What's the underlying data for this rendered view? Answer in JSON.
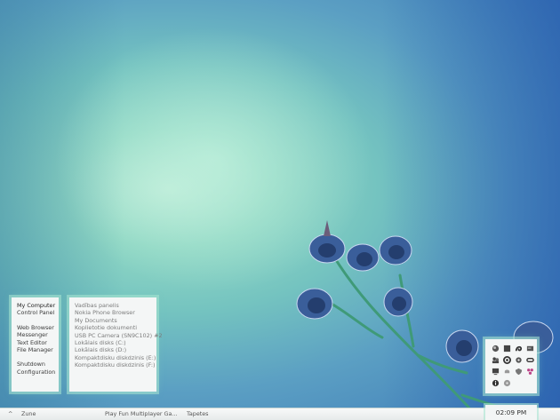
{
  "start_menu": {
    "left_items": [
      "My Computer",
      "Control Panel",
      "Web Browser",
      "Messenger",
      "Text Editor",
      "File Manager",
      "Shutdown",
      "Configuration"
    ],
    "right_items": [
      "Vadības panelis",
      "Nokia Phone Browser",
      "My Documents",
      "Koplietotie dokumenti",
      "USB PC Camera (SN9C102) #2",
      "Lokālais disks (C:)",
      "Lokālais disks (D:)",
      "Kompaktdisku diskdzinis (E:)",
      "Kompaktdisku diskdzinis (F:)"
    ]
  },
  "taskbar": {
    "arrow": "^",
    "tasks": [
      "Zune",
      "Play Fun Multiplayer Ga...",
      "Tapetes"
    ]
  },
  "clock": {
    "time": "02:09 PM"
  },
  "tray_icons": [
    "globe-icon",
    "window-icon",
    "swirl-icon",
    "card-icon",
    "people-icon",
    "spiral-icon",
    "gear-icon",
    "link-icon",
    "monitor-icon",
    "bell-icon",
    "shield-icon",
    "flower-icon",
    "info-icon",
    "disc-icon"
  ]
}
